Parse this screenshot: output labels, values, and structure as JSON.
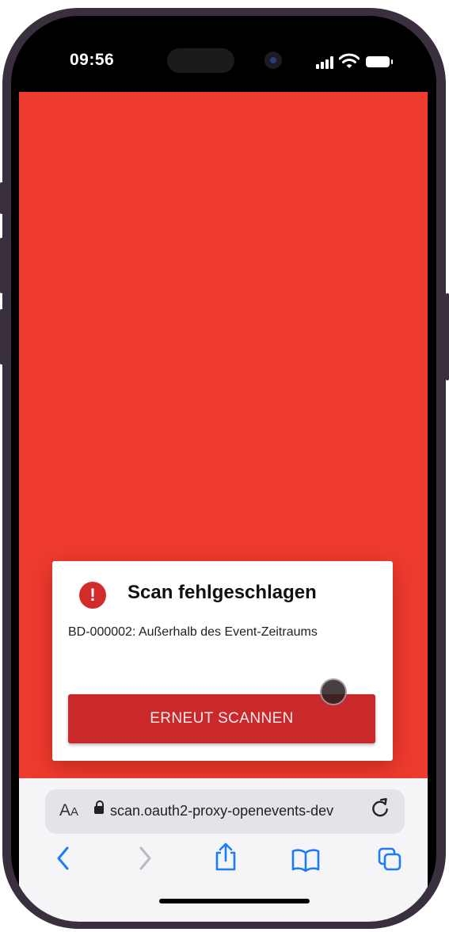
{
  "status_bar": {
    "time": "09:56"
  },
  "dialog": {
    "icon": "exclamation-icon",
    "title": "Scan fehlgeschlagen",
    "message": "BD-000002: Außerhalb des Event-Zeitraums",
    "button_label": "ERNEUT SCANNEN"
  },
  "browser": {
    "text_size_label": "AA",
    "url": "scan.oauth2-proxy-openevents-dev",
    "back_icon": "chevron-left-icon",
    "forward_icon": "chevron-right-icon",
    "share_icon": "share-icon",
    "bookmarks_icon": "book-icon",
    "tabs_icon": "tabs-icon",
    "reload_icon": "reload-icon"
  },
  "colors": {
    "page_background": "#ef3b2f",
    "button": "#c9292a",
    "error_icon": "#d32a2a",
    "toolbar_accent": "#1c7bf5"
  }
}
